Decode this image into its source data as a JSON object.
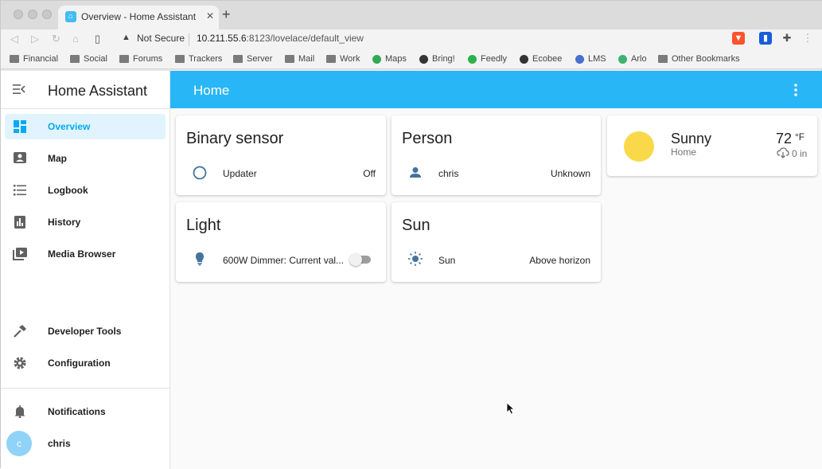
{
  "browser": {
    "tab_title": "Overview - Home Assistant",
    "tab_close": "✕",
    "new_tab": "+",
    "not_secure": "Not Secure",
    "url_host": "10.211.55.6",
    "url_rest": ":8123/lovelace/default_view",
    "bookmarks": [
      "Financial",
      "Social",
      "Forums",
      "Trackers",
      "Server",
      "Mail",
      "Work",
      "Maps",
      "Bring!",
      "Feedly",
      "Ecobee",
      "LMS",
      "Arlo",
      "Other Bookmarks"
    ]
  },
  "sidebar": {
    "title": "Home Assistant",
    "items": [
      {
        "label": "Overview",
        "icon": "view-dashboard-icon",
        "active": true
      },
      {
        "label": "Map",
        "icon": "map-icon"
      },
      {
        "label": "Logbook",
        "icon": "logbook-icon"
      },
      {
        "label": "History",
        "icon": "history-chart-icon"
      },
      {
        "label": "Media Browser",
        "icon": "media-browser-icon"
      },
      {
        "label": "Developer Tools",
        "icon": "hammer-icon"
      },
      {
        "label": "Configuration",
        "icon": "gear-icon"
      },
      {
        "label": "Notifications",
        "icon": "bell-icon"
      },
      {
        "label": "chris",
        "icon": "avatar"
      }
    ],
    "avatar_initial": "c"
  },
  "header": {
    "title": "Home"
  },
  "cards": {
    "binary_sensor": {
      "title": "Binary sensor",
      "entity": "Updater",
      "state": "Off"
    },
    "person": {
      "title": "Person",
      "entity": "chris",
      "state": "Unknown"
    },
    "light": {
      "title": "Light",
      "entity": "600W Dimmer: Current val...",
      "toggle_on": false
    },
    "sun": {
      "title": "Sun",
      "entity": "Sun",
      "state": "Above horizon"
    },
    "weather": {
      "condition": "Sunny",
      "location": "Home",
      "temperature": "72",
      "unit": "°F",
      "precipitation": "0 in"
    }
  },
  "colors": {
    "accent": "#03a9f4",
    "header": "#29b6f6",
    "icon": "#44739e",
    "sun": "#f9d949"
  }
}
